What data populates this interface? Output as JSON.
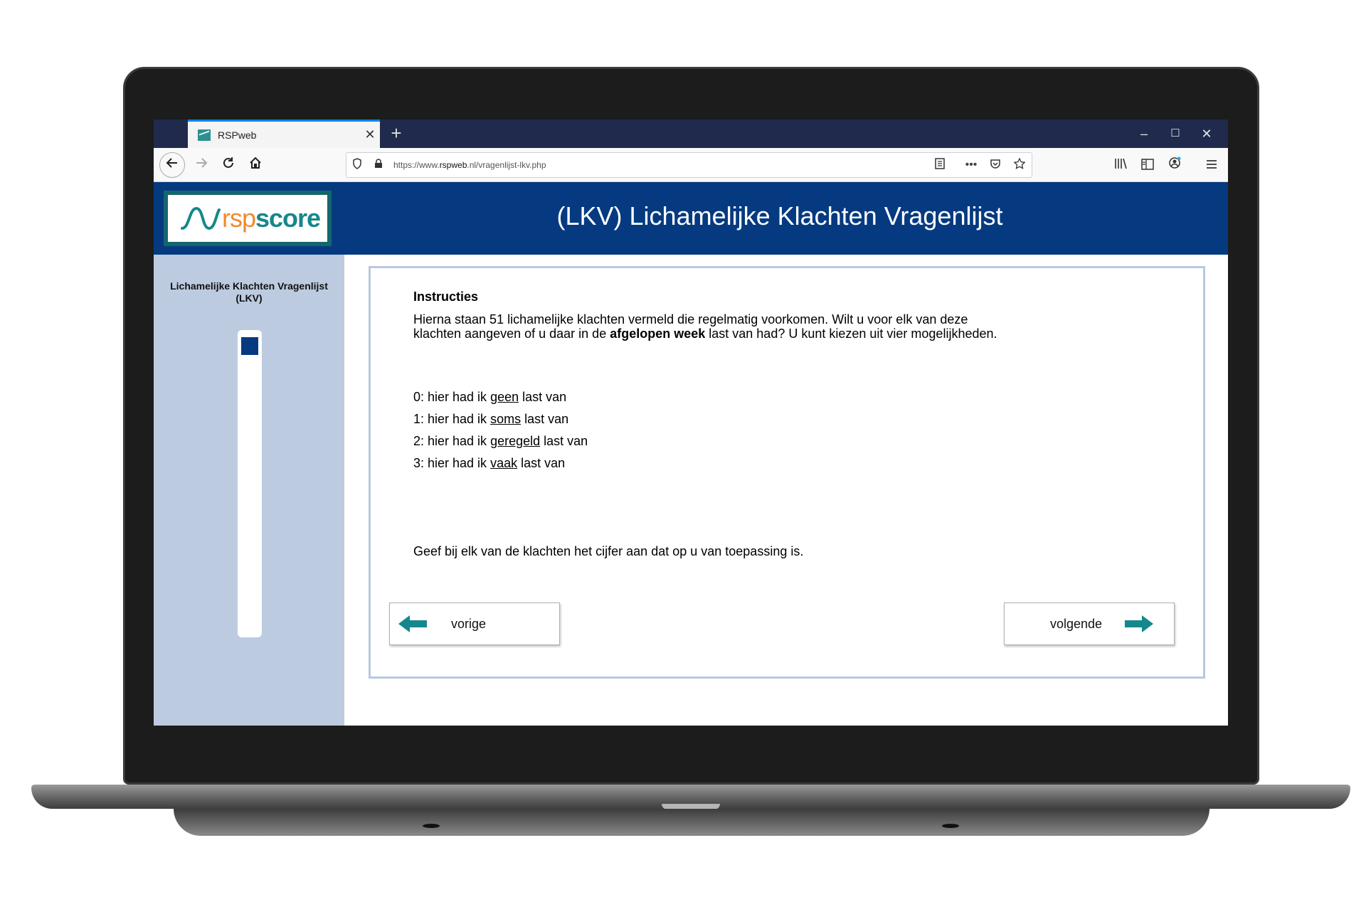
{
  "browser": {
    "tab_title": "RSPweb",
    "tab_close": "✕",
    "new_tab": "+",
    "url_prefix": "https://www.",
    "url_domain": "rspweb",
    "url_suffix": ".nl/vragenlijst-lkv.php",
    "window_minimize": "–",
    "window_maximize": "☐",
    "window_close": "✕"
  },
  "header": {
    "logo_rsp": "rsp",
    "logo_score": "score",
    "title": "(LKV) Lichamelijke Klachten Vragenlijst"
  },
  "sidebar": {
    "title": "Lichamelijke Klachten Vragenlijst (LKV)",
    "progress_fraction": 0.06
  },
  "content": {
    "heading": "Instructies",
    "intro_part1": "Hierna staan 51 lichamelijke klachten vermeld die regelmatig voorkomen. Wilt u voor elk van deze klachten aangeven of u daar in de ",
    "intro_bold": "afgelopen week",
    "intro_part2": " last van had? U kunt kiezen uit vier mogelijkheden.",
    "options": [
      {
        "prefix": "0: hier had ik ",
        "key": "geen",
        "suffix": " last van"
      },
      {
        "prefix": "1: hier had ik ",
        "key": "soms",
        "suffix": " last van"
      },
      {
        "prefix": "2: hier had ik ",
        "key": "geregeld",
        "suffix": " last van"
      },
      {
        "prefix": "3: hier had ik ",
        "key": "vaak",
        "suffix": " last van"
      }
    ],
    "footer": "Geef bij elk van de klachten het cijfer aan dat op u van toepassing is.",
    "prev_label": "vorige",
    "next_label": "volgende"
  },
  "colors": {
    "header_bg": "#053a80",
    "sidebar_bg": "#bccbe0",
    "arrow": "#16878c",
    "logo_orange": "#f08a2c"
  }
}
